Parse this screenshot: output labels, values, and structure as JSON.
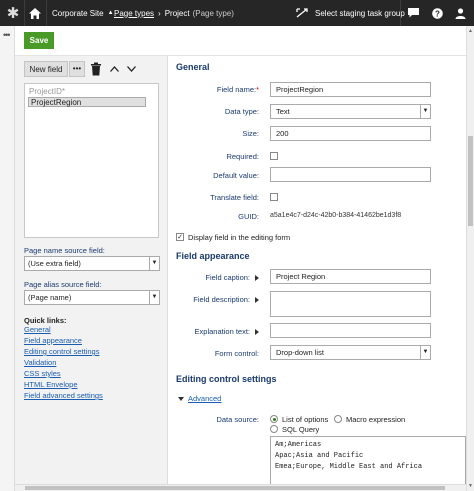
{
  "topbar": {
    "site": "Corporate Site",
    "breadcrumb_link": "Page types",
    "breadcrumb_current": "Project",
    "breadcrumb_type": "(Page type)",
    "staging": "Select staging task group"
  },
  "toolbar": {
    "save_label": "Save"
  },
  "left": {
    "new_field": "New field",
    "more": "•••",
    "fields": [
      "ProjectID*",
      "ProjectRegion"
    ],
    "page_name_label": "Page name source field:",
    "page_name_value": "(Use extra field)",
    "page_alias_label": "Page alias source field:",
    "page_alias_value": "(Page name)",
    "quick_links_title": "Quick links:",
    "quick_links": [
      "General",
      "Field appearance",
      "Editing control settings",
      "Validation",
      "CSS styles",
      "HTML Envelope",
      "Field advanced settings"
    ]
  },
  "general": {
    "heading": "General",
    "field_name_label": "Field name:",
    "field_name_required": "*",
    "field_name_value": "ProjectRegion",
    "data_type_label": "Data type:",
    "data_type_value": "Text",
    "size_label": "Size:",
    "size_value": "200",
    "required_label": "Required:",
    "required_checked": false,
    "default_label": "Default value:",
    "default_value": "",
    "translate_label": "Translate field:",
    "translate_checked": false,
    "guid_label": "GUID:",
    "guid_value": "a5a1e4c7-d24c-42b0-b384-41462be1d3f8",
    "display_label": "Display field in the editing form",
    "display_checked": true
  },
  "appearance": {
    "heading": "Field appearance",
    "caption_label": "Field caption:",
    "caption_value": "Project Region",
    "description_label": "Field description:",
    "explanation_label": "Explanation text:",
    "form_control_label": "Form control:",
    "form_control_value": "Drop-down list"
  },
  "editing": {
    "heading": "Editing control settings",
    "advanced_label": "Advanced",
    "data_source_label": "Data source:",
    "options": [
      "List of options",
      "Macro expression",
      "SQL Query"
    ],
    "selected_option": "List of options",
    "list_lines": [
      "Am;Americas",
      "Apac;Asia and Pacific",
      "Emea;Europe, Middle East and Africa"
    ]
  },
  "colors": {
    "save_green": "#4a9a28",
    "label_blue": "#1a3a6e",
    "topbar": "#262626"
  }
}
